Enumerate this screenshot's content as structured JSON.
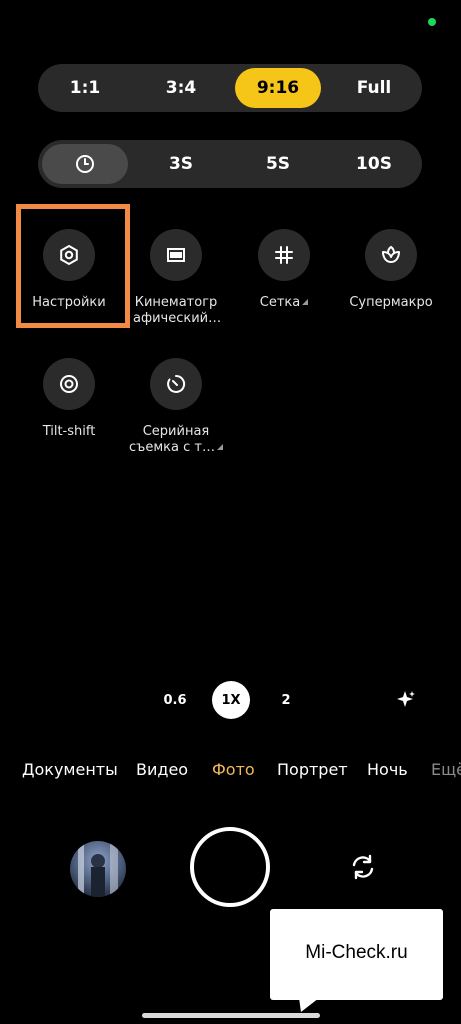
{
  "aspect_ratio": {
    "options": [
      "1:1",
      "3:4",
      "9:16",
      "Full"
    ],
    "selected": "9:16"
  },
  "timer": {
    "options": [
      "3S",
      "5S",
      "10S"
    ],
    "selected_icon": "clock-icon"
  },
  "tiles": [
    {
      "label": "Настройки",
      "icon": "gear-icon"
    },
    {
      "label": "Кинематогр афический…",
      "icon": "cinematic-frame-icon"
    },
    {
      "label": "Сетка",
      "icon": "grid-icon"
    },
    {
      "label": "Супермакро",
      "icon": "flower-macro-icon"
    },
    {
      "label": "Tilt-shift",
      "icon": "tilt-shift-icon"
    },
    {
      "label": "Серийная съемка с т…",
      "icon": "burst-timer-icon"
    }
  ],
  "zoom": {
    "options": [
      "0.6",
      "1X",
      "2"
    ],
    "selected": "1X"
  },
  "modes": [
    "Документы",
    "Видео",
    "Фото",
    "Портрет",
    "Ночь",
    "Ещё"
  ],
  "active_mode": "Фото",
  "watermark": "Mi-Check.ru",
  "colors": {
    "accent_yellow": "#f5c518",
    "highlight_orange": "#f08a45",
    "active_mode": "#f0b95a",
    "status_green": "#1ed760"
  }
}
